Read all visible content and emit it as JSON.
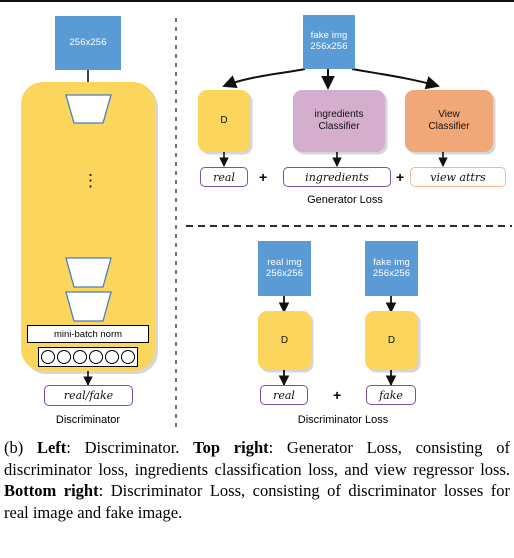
{
  "figure": {
    "colors": {
      "blue": "#5b9bd5",
      "yellow": "#fcd55c",
      "pink": "#d6aecd",
      "orange": "#f0a878",
      "pill_border": "#7d4fa8",
      "peach_border": "#f3b892",
      "arrow": "#111111"
    },
    "left_panel": {
      "input_block": {
        "line1": "256x256"
      },
      "mini_batch_norm_label": "mini-batch norm",
      "neuron_count": 6,
      "output_pill": "real/fake",
      "caption": "Discriminator",
      "dots": "⋮"
    },
    "top_right_panel": {
      "input_block": {
        "line1": "fake img",
        "line2": "256x256"
      },
      "branches": [
        {
          "name": "discriminator",
          "label_line1": "D",
          "label_line2": "",
          "color": "yellow",
          "output": "real",
          "output_style": "purple"
        },
        {
          "name": "ingredients-classifier",
          "label_line1": "ingredients",
          "label_line2": "Classifier",
          "color": "pink",
          "output": "ingredients",
          "output_style": "purple"
        },
        {
          "name": "view-classifier",
          "label_line1": "View",
          "label_line2": "Classifier",
          "color": "orange",
          "output": "view attrs",
          "output_style": "peach"
        }
      ],
      "operators": [
        "+",
        "+"
      ],
      "caption": "Generator Loss"
    },
    "bottom_right_panel": {
      "columns": [
        {
          "input_line1": "real img",
          "input_line2": "256x256",
          "module": "D",
          "output": "real"
        },
        {
          "input_line1": "fake img",
          "input_line2": "256x256",
          "module": "D",
          "output": "fake"
        }
      ],
      "operator": "+",
      "caption": "Discriminator Loss"
    }
  },
  "caption": {
    "prefix": "(b) ",
    "b1": "Left",
    "t1": ": Discriminator. ",
    "b2": "Top right",
    "t2": ": Generator Loss, consisting of discriminator loss, ingredients classification loss, and view regressor loss. ",
    "b3": "Bottom right",
    "t3": ": Discriminator Loss, consisting of discriminator losses for real image and fake image."
  }
}
